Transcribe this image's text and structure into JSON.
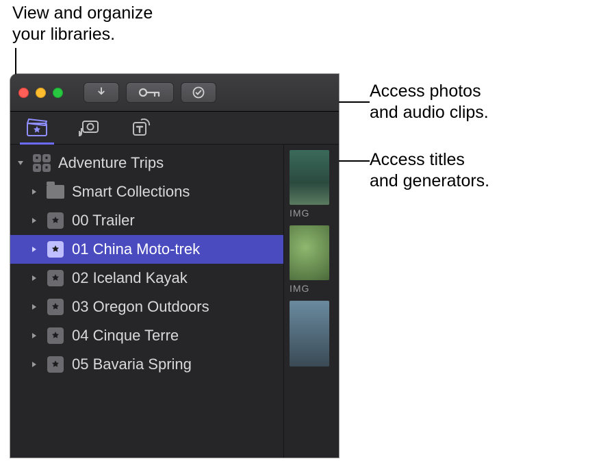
{
  "callouts": {
    "libraries": "View and organize\nyour libraries.",
    "photos_audio": "Access photos\nand audio clips.",
    "titles_gen": "Access titles\nand generators."
  },
  "library": {
    "name": "Adventure Trips",
    "items": [
      {
        "label": "Smart Collections",
        "kind": "folder"
      },
      {
        "label": "00 Trailer",
        "kind": "event"
      },
      {
        "label": "01 China Moto-trek",
        "kind": "event",
        "selected": true
      },
      {
        "label": "02 Iceland Kayak",
        "kind": "event"
      },
      {
        "label": "03 Oregon Outdoors",
        "kind": "event"
      },
      {
        "label": "04 Cinque Terre",
        "kind": "event"
      },
      {
        "label": "05 Bavaria Spring",
        "kind": "event"
      }
    ]
  },
  "thumbs": [
    {
      "label": "IMG"
    },
    {
      "label": "IMG"
    },
    {
      "label": ""
    }
  ]
}
